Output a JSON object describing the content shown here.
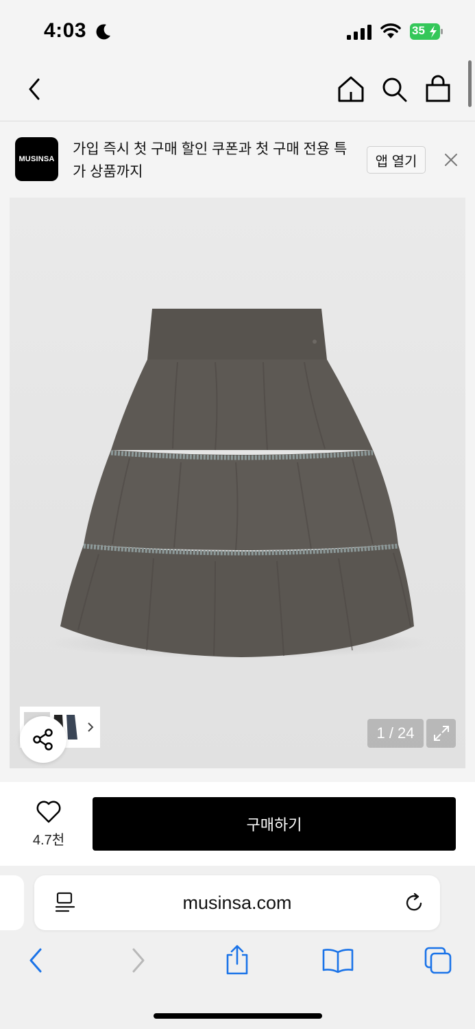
{
  "status_bar": {
    "time": "4:03",
    "battery": "35",
    "icons": [
      "moon-icon",
      "signal-icon",
      "wifi-icon",
      "battery-icon"
    ]
  },
  "nav": {
    "icons": [
      "back-chevron-icon",
      "home-icon",
      "search-icon",
      "shopping-bag-icon"
    ]
  },
  "banner": {
    "logo_text": "MUSINSA",
    "message": "가입 즉시 첫 구매 할인 쿠폰과 첫 구매 전용 특가 상품까지",
    "open_app_label": "앱 열기"
  },
  "product_image": {
    "counter": "1 / 24",
    "description_icon": "skirt-image"
  },
  "purchase_bar": {
    "like_count": "4.7천",
    "buy_label": "구매하기"
  },
  "safari": {
    "url": "musinsa.com",
    "icons": [
      "reader-icon",
      "reload-icon",
      "back-icon",
      "forward-icon",
      "share-icon",
      "bookmarks-icon",
      "tabs-icon"
    ]
  },
  "colors": {
    "accent": "#000000",
    "battery_green": "#34c759",
    "safari_blue": "#1a73e8"
  }
}
